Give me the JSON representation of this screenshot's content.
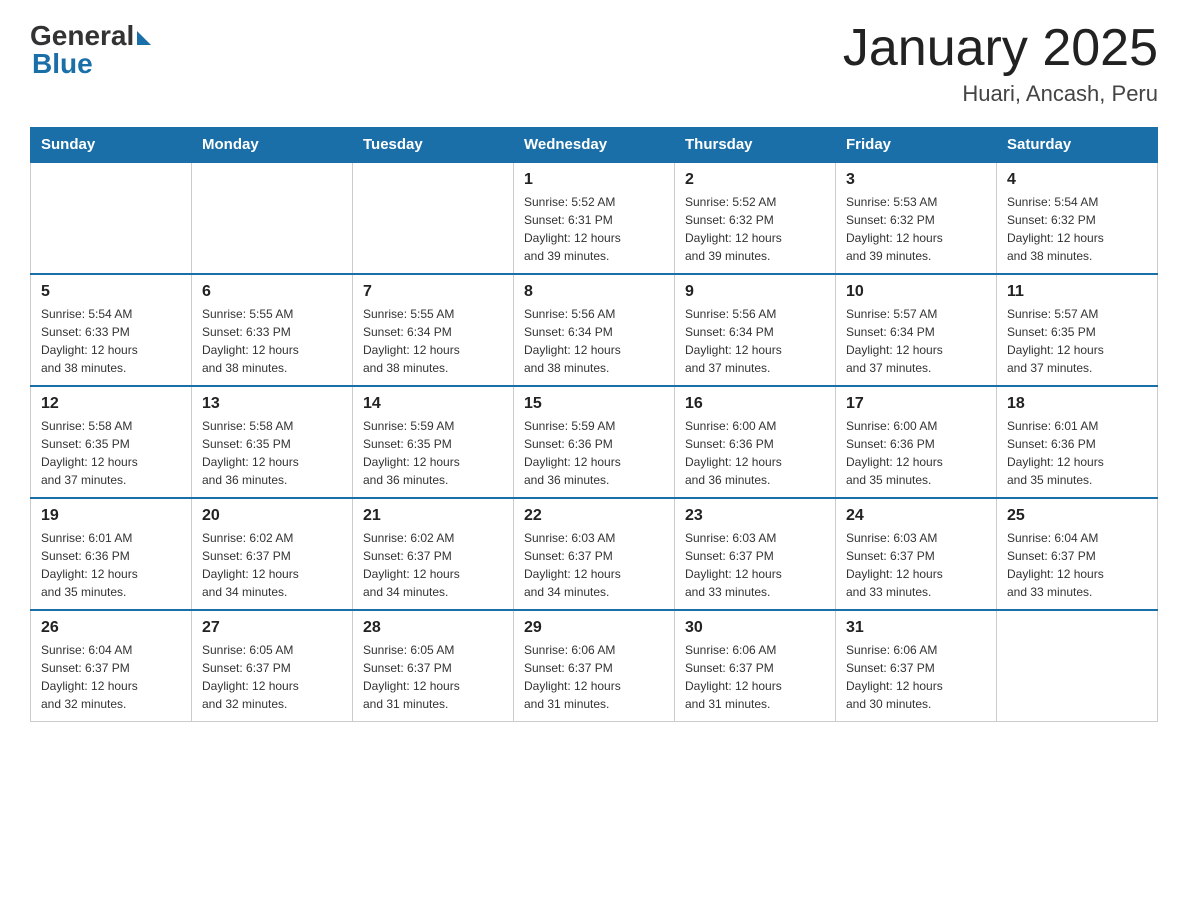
{
  "logo": {
    "general": "General",
    "blue": "Blue"
  },
  "title": "January 2025",
  "subtitle": "Huari, Ancash, Peru",
  "days_header": [
    "Sunday",
    "Monday",
    "Tuesday",
    "Wednesday",
    "Thursday",
    "Friday",
    "Saturday"
  ],
  "weeks": [
    [
      {
        "num": "",
        "info": ""
      },
      {
        "num": "",
        "info": ""
      },
      {
        "num": "",
        "info": ""
      },
      {
        "num": "1",
        "info": "Sunrise: 5:52 AM\nSunset: 6:31 PM\nDaylight: 12 hours\nand 39 minutes."
      },
      {
        "num": "2",
        "info": "Sunrise: 5:52 AM\nSunset: 6:32 PM\nDaylight: 12 hours\nand 39 minutes."
      },
      {
        "num": "3",
        "info": "Sunrise: 5:53 AM\nSunset: 6:32 PM\nDaylight: 12 hours\nand 39 minutes."
      },
      {
        "num": "4",
        "info": "Sunrise: 5:54 AM\nSunset: 6:32 PM\nDaylight: 12 hours\nand 38 minutes."
      }
    ],
    [
      {
        "num": "5",
        "info": "Sunrise: 5:54 AM\nSunset: 6:33 PM\nDaylight: 12 hours\nand 38 minutes."
      },
      {
        "num": "6",
        "info": "Sunrise: 5:55 AM\nSunset: 6:33 PM\nDaylight: 12 hours\nand 38 minutes."
      },
      {
        "num": "7",
        "info": "Sunrise: 5:55 AM\nSunset: 6:34 PM\nDaylight: 12 hours\nand 38 minutes."
      },
      {
        "num": "8",
        "info": "Sunrise: 5:56 AM\nSunset: 6:34 PM\nDaylight: 12 hours\nand 38 minutes."
      },
      {
        "num": "9",
        "info": "Sunrise: 5:56 AM\nSunset: 6:34 PM\nDaylight: 12 hours\nand 37 minutes."
      },
      {
        "num": "10",
        "info": "Sunrise: 5:57 AM\nSunset: 6:34 PM\nDaylight: 12 hours\nand 37 minutes."
      },
      {
        "num": "11",
        "info": "Sunrise: 5:57 AM\nSunset: 6:35 PM\nDaylight: 12 hours\nand 37 minutes."
      }
    ],
    [
      {
        "num": "12",
        "info": "Sunrise: 5:58 AM\nSunset: 6:35 PM\nDaylight: 12 hours\nand 37 minutes."
      },
      {
        "num": "13",
        "info": "Sunrise: 5:58 AM\nSunset: 6:35 PM\nDaylight: 12 hours\nand 36 minutes."
      },
      {
        "num": "14",
        "info": "Sunrise: 5:59 AM\nSunset: 6:35 PM\nDaylight: 12 hours\nand 36 minutes."
      },
      {
        "num": "15",
        "info": "Sunrise: 5:59 AM\nSunset: 6:36 PM\nDaylight: 12 hours\nand 36 minutes."
      },
      {
        "num": "16",
        "info": "Sunrise: 6:00 AM\nSunset: 6:36 PM\nDaylight: 12 hours\nand 36 minutes."
      },
      {
        "num": "17",
        "info": "Sunrise: 6:00 AM\nSunset: 6:36 PM\nDaylight: 12 hours\nand 35 minutes."
      },
      {
        "num": "18",
        "info": "Sunrise: 6:01 AM\nSunset: 6:36 PM\nDaylight: 12 hours\nand 35 minutes."
      }
    ],
    [
      {
        "num": "19",
        "info": "Sunrise: 6:01 AM\nSunset: 6:36 PM\nDaylight: 12 hours\nand 35 minutes."
      },
      {
        "num": "20",
        "info": "Sunrise: 6:02 AM\nSunset: 6:37 PM\nDaylight: 12 hours\nand 34 minutes."
      },
      {
        "num": "21",
        "info": "Sunrise: 6:02 AM\nSunset: 6:37 PM\nDaylight: 12 hours\nand 34 minutes."
      },
      {
        "num": "22",
        "info": "Sunrise: 6:03 AM\nSunset: 6:37 PM\nDaylight: 12 hours\nand 34 minutes."
      },
      {
        "num": "23",
        "info": "Sunrise: 6:03 AM\nSunset: 6:37 PM\nDaylight: 12 hours\nand 33 minutes."
      },
      {
        "num": "24",
        "info": "Sunrise: 6:03 AM\nSunset: 6:37 PM\nDaylight: 12 hours\nand 33 minutes."
      },
      {
        "num": "25",
        "info": "Sunrise: 6:04 AM\nSunset: 6:37 PM\nDaylight: 12 hours\nand 33 minutes."
      }
    ],
    [
      {
        "num": "26",
        "info": "Sunrise: 6:04 AM\nSunset: 6:37 PM\nDaylight: 12 hours\nand 32 minutes."
      },
      {
        "num": "27",
        "info": "Sunrise: 6:05 AM\nSunset: 6:37 PM\nDaylight: 12 hours\nand 32 minutes."
      },
      {
        "num": "28",
        "info": "Sunrise: 6:05 AM\nSunset: 6:37 PM\nDaylight: 12 hours\nand 31 minutes."
      },
      {
        "num": "29",
        "info": "Sunrise: 6:06 AM\nSunset: 6:37 PM\nDaylight: 12 hours\nand 31 minutes."
      },
      {
        "num": "30",
        "info": "Sunrise: 6:06 AM\nSunset: 6:37 PM\nDaylight: 12 hours\nand 31 minutes."
      },
      {
        "num": "31",
        "info": "Sunrise: 6:06 AM\nSunset: 6:37 PM\nDaylight: 12 hours\nand 30 minutes."
      },
      {
        "num": "",
        "info": ""
      }
    ]
  ]
}
